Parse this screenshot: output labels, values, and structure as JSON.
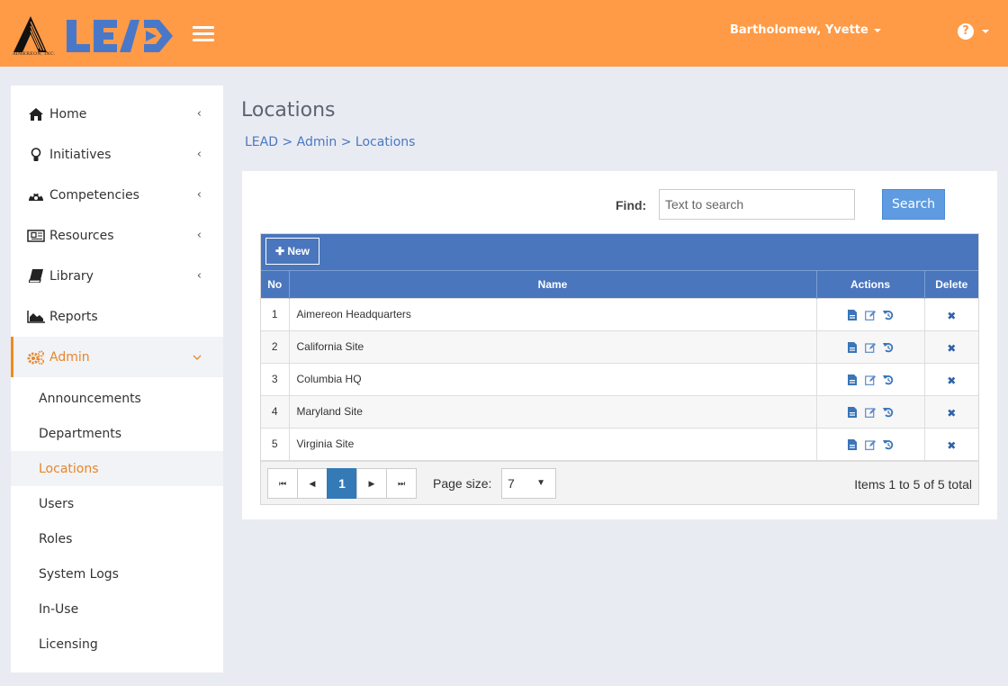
{
  "header": {
    "brand": "LEAD",
    "company": "AIMEREON, INC.",
    "user_name": "Bartholomew, Yvette",
    "help_glyph": "?",
    "colors": {
      "topbar": "#ff9a47",
      "brand": "#4a78c8",
      "accent": "#e8862a"
    }
  },
  "sidebar": {
    "items": [
      {
        "label": "Home",
        "icon": "home-icon",
        "chevron": "‹"
      },
      {
        "label": "Initiatives",
        "icon": "lightbulb-icon",
        "chevron": "‹"
      },
      {
        "label": "Competencies",
        "icon": "dashboard-icon",
        "chevron": "‹"
      },
      {
        "label": "Resources",
        "icon": "newspaper-icon",
        "chevron": "‹"
      },
      {
        "label": "Library",
        "icon": "book-icon",
        "chevron": "‹"
      },
      {
        "label": "Reports",
        "icon": "area-chart-icon"
      },
      {
        "label": "Admin",
        "icon": "gears-icon",
        "chevron": "⌄",
        "active": true
      }
    ],
    "admin_sub": [
      {
        "label": "Announcements"
      },
      {
        "label": "Departments"
      },
      {
        "label": "Locations",
        "current": true
      },
      {
        "label": "Users"
      },
      {
        "label": "Roles"
      },
      {
        "label": "System Logs"
      },
      {
        "label": "In-Use"
      },
      {
        "label": "Licensing"
      }
    ]
  },
  "main": {
    "title": "Locations",
    "breadcrumb": [
      "LEAD",
      "Admin",
      "Locations"
    ],
    "breadcrumb_sep": ">",
    "find_label": "Find:",
    "find_placeholder": "Text to search",
    "find_value": "",
    "search_label": "Search",
    "new_label": "New",
    "columns": [
      "No",
      "Name",
      "Actions",
      "Delete"
    ],
    "rows": [
      {
        "no": "1",
        "name": "Aimereon Headquarters"
      },
      {
        "no": "2",
        "name": "California Site"
      },
      {
        "no": "3",
        "name": "Columbia HQ"
      },
      {
        "no": "4",
        "name": "Maryland Site"
      },
      {
        "no": "5",
        "name": "Virginia Site"
      }
    ],
    "pager": {
      "current_page": "1",
      "page_size_label": "Page size:",
      "page_size": "7",
      "info": "Items 1 to 5 of 5 total"
    }
  }
}
